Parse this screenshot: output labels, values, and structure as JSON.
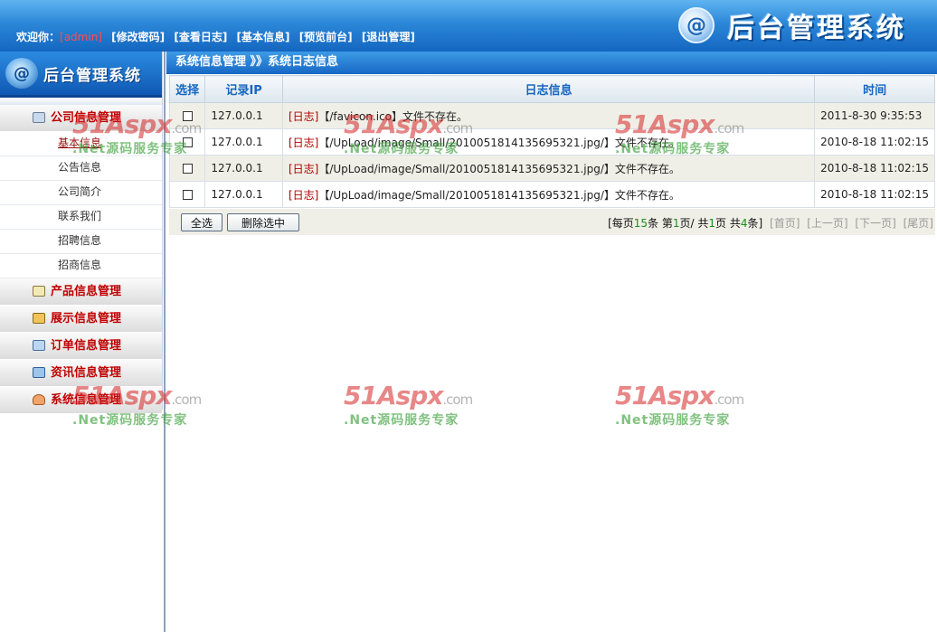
{
  "header": {
    "welcome_prefix": "欢迎你：",
    "username": "[admin]",
    "links": [
      "[修改密码]",
      "[查看日志]",
      "[基本信息]",
      "[预览前台]",
      "[退出管理]"
    ],
    "logo_icon": "@",
    "logo_title": "后台管理系统"
  },
  "sidebar": {
    "brand_title": "后台管理系统",
    "sections": [
      {
        "label": "公司信息管理",
        "icon": "monitor-icon",
        "items": [
          "基本信息",
          "公告信息",
          "公司简介",
          "联系我们",
          "招聘信息",
          "招商信息"
        ]
      },
      {
        "label": "产品信息管理",
        "icon": "notepad-icon"
      },
      {
        "label": "展示信息管理",
        "icon": "folder-icon"
      },
      {
        "label": "订单信息管理",
        "icon": "edit-icon"
      },
      {
        "label": "资讯信息管理",
        "icon": "news-icon"
      },
      {
        "label": "系统信息管理",
        "icon": "user-icon"
      }
    ]
  },
  "breadcrumb": "系统信息管理 》》系统日志信息",
  "table": {
    "headers": [
      "选择",
      "记录IP",
      "日志信息",
      "时间"
    ],
    "rows": [
      {
        "ip": "127.0.0.1",
        "tag": "[日志]",
        "message": "【/favicon.ico】文件不存在。",
        "time": "2011-8-30 9:35:53"
      },
      {
        "ip": "127.0.0.1",
        "tag": "[日志]",
        "message": "【/UpLoad/image/Small/2010051814135695321.jpg/】文件不存在。",
        "time": "2010-8-18 11:02:15"
      },
      {
        "ip": "127.0.0.1",
        "tag": "[日志]",
        "message": "【/UpLoad/image/Small/2010051814135695321.jpg/】文件不存在。",
        "time": "2010-8-18 11:02:15"
      },
      {
        "ip": "127.0.0.1",
        "tag": "[日志]",
        "message": "【/UpLoad/image/Small/2010051814135695321.jpg/】文件不存在。",
        "time": "2010-8-18 11:02:15"
      }
    ]
  },
  "actions": {
    "select_all": "全选",
    "delete_selected": "删除选中"
  },
  "pager": {
    "p1": "[每页",
    "per_page": "15",
    "p2": "条 第",
    "current": "1",
    "p3": "页/ 共",
    "pages": "1",
    "p4": "页 共",
    "total": "4",
    "p5": "条]",
    "first": "[首页]",
    "prev": "[上一页]",
    "next": "[下一页]",
    "last": "[尾页]"
  },
  "watermark": {
    "brand": "51Aspx",
    "domain": ".com",
    "slogan": ".Net源码服务专家"
  }
}
